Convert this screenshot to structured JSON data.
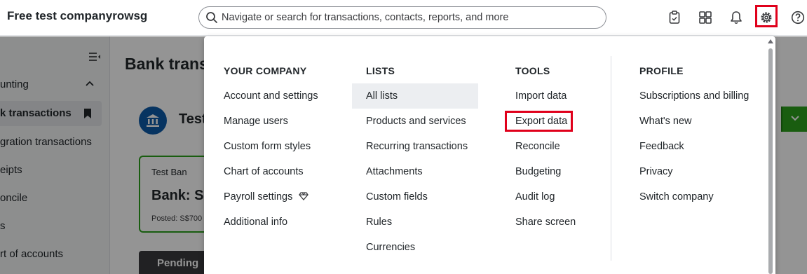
{
  "header": {
    "company_name": "Free test companyrowsg",
    "search_placeholder": "Navigate or search for transactions, contacts, reports, and more"
  },
  "sidebar": {
    "section": "unting",
    "active_item": "k transactions",
    "items": [
      "gration transactions",
      "eipts",
      "oncile",
      "s",
      "rt of accounts"
    ]
  },
  "main": {
    "page_title": "Bank trans",
    "account_name": "Test",
    "card": {
      "name": "Test Ban",
      "title": "Bank: S",
      "posted": "Posted: S$700"
    },
    "pending_tab": "Pending"
  },
  "gear_menu": {
    "your_company": {
      "heading": "YOUR COMPANY",
      "items": [
        "Account and settings",
        "Manage users",
        "Custom form styles",
        "Chart of accounts",
        "Payroll settings",
        "Additional info"
      ]
    },
    "lists": {
      "heading": "LISTS",
      "items": [
        "All lists",
        "Products and services",
        "Recurring transactions",
        "Attachments",
        "Custom fields",
        "Rules",
        "Currencies"
      ]
    },
    "tools": {
      "heading": "TOOLS",
      "items": [
        "Import data",
        "Export data",
        "Reconcile",
        "Budgeting",
        "Audit log",
        "Share screen"
      ]
    },
    "profile": {
      "heading": "PROFILE",
      "items": [
        "Subscriptions and billing",
        "What's new",
        "Feedback",
        "Privacy",
        "Switch company"
      ]
    }
  },
  "colors": {
    "highlight_red": "#e0001b",
    "brand_green": "#2ca01c",
    "bank_blue": "#0d5aa7"
  },
  "icons": [
    "search-icon",
    "clipboard-icon",
    "apps-icon",
    "bell-icon",
    "gear-icon",
    "help-icon",
    "collapse-sidebar-icon",
    "chevron-up-icon",
    "bookmark-icon",
    "bank-icon",
    "premium-diamond-icon",
    "chevron-down-icon"
  ]
}
